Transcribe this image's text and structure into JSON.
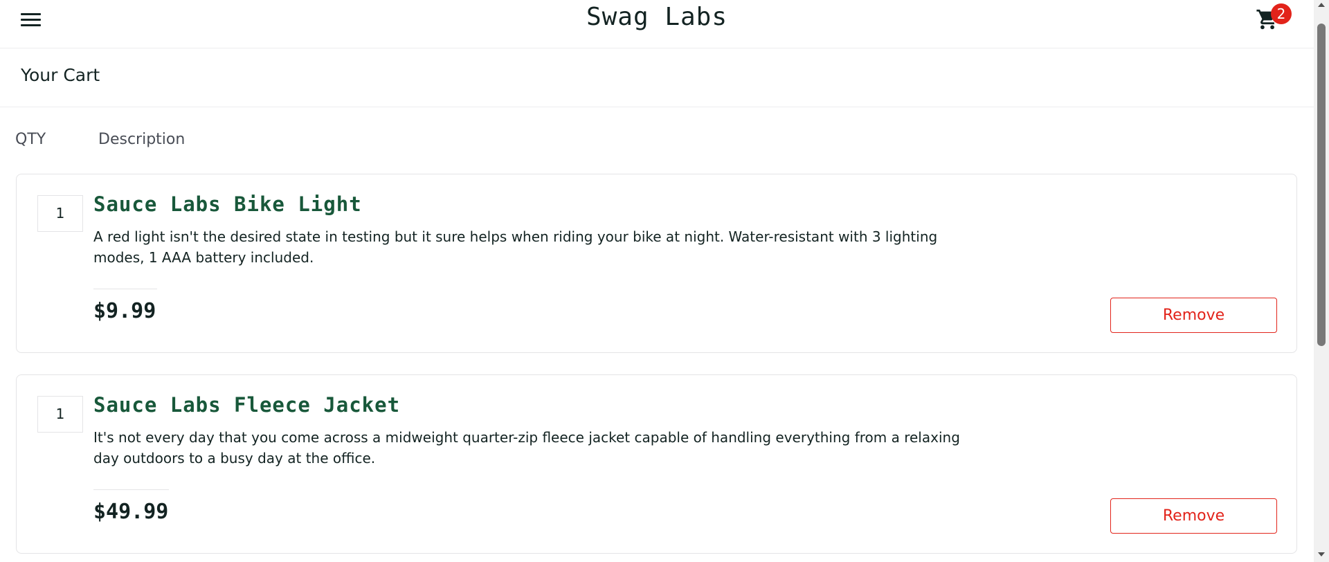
{
  "header": {
    "logo": "Swag Labs",
    "menu_icon": "hamburger-menu-icon",
    "cart_icon": "shopping-cart-icon",
    "cart_badge": "2",
    "badge_color": "#e2231a"
  },
  "secondary_header": {
    "title": "Your Cart"
  },
  "cart_labels": {
    "qty": "QTY",
    "description": "Description"
  },
  "cart_items": [
    {
      "quantity": "1",
      "name": "Sauce Labs Bike Light",
      "description": "A red light isn't the desired state in testing but it sure helps when riding your bike at night. Water-resistant with 3 lighting modes, 1 AAA battery included.",
      "price": "$9.99",
      "remove_label": "Remove"
    },
    {
      "quantity": "1",
      "name": "Sauce Labs Fleece Jacket",
      "description": "It's not every day that you come across a midweight quarter-zip fleece jacket capable of handling everything from a relaxing day outdoors to a busy day at the office.",
      "price": "$49.99",
      "remove_label": "Remove"
    }
  ],
  "colors": {
    "item_name": "#18583a",
    "remove_button": "#e2231a",
    "text": "#132322"
  }
}
